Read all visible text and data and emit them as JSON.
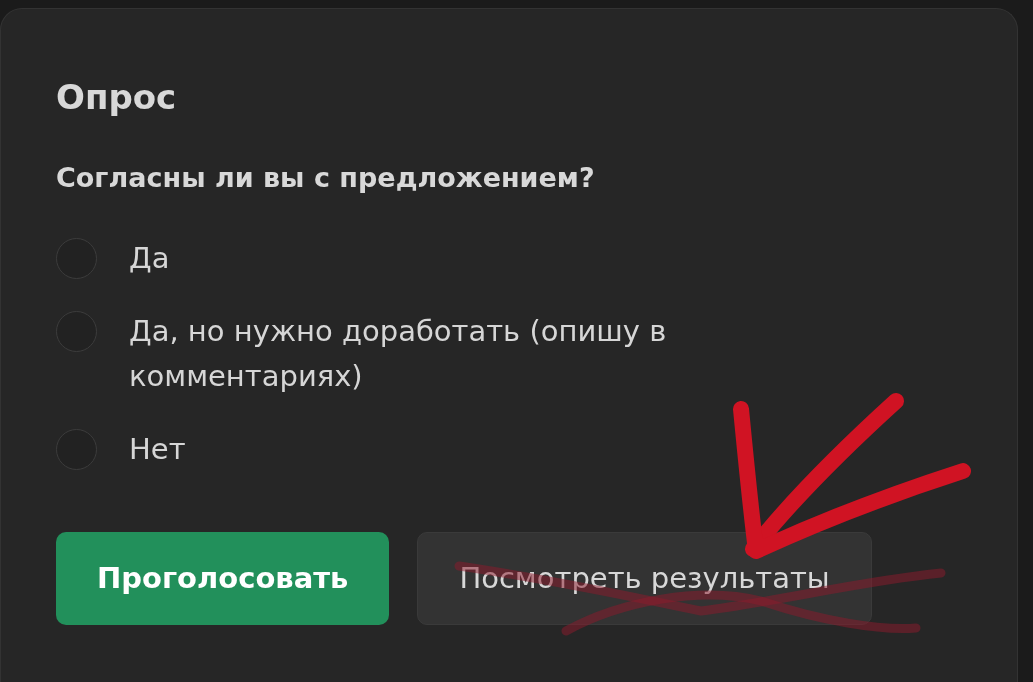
{
  "poll": {
    "title": "Опрос",
    "question": "Согласны ли вы с предложением?",
    "options": [
      {
        "label": "Да",
        "selected": false
      },
      {
        "label": "Да, но нужно доработать (опишу в комментариях)",
        "selected": false
      },
      {
        "label": "Нет",
        "selected": false
      }
    ],
    "buttons": [
      {
        "label": "Проголосовать",
        "kind": "primary"
      },
      {
        "label": "Посмотреть результаты",
        "kind": "secondary"
      }
    ]
  }
}
